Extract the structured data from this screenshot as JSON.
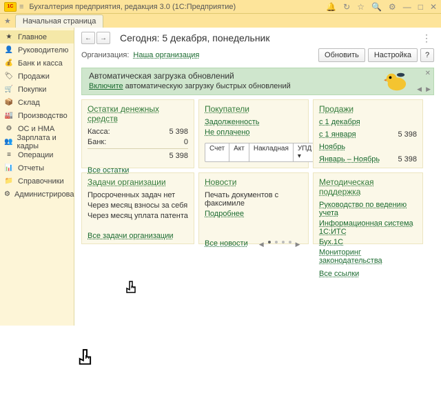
{
  "titlebar": {
    "title": "Бухгалтерия предприятия, редакция 3.0  (1С:Предприятие)"
  },
  "tab": {
    "label": "Начальная страница"
  },
  "sidebar": {
    "items": [
      {
        "label": "Главное",
        "icon": "★"
      },
      {
        "label": "Руководителю",
        "icon": "👤"
      },
      {
        "label": "Банк и касса",
        "icon": "💰"
      },
      {
        "label": "Продажи",
        "icon": "🏷"
      },
      {
        "label": "Покупки",
        "icon": "🛒"
      },
      {
        "label": "Склад",
        "icon": "📦"
      },
      {
        "label": "Производство",
        "icon": "🏭"
      },
      {
        "label": "ОС и НМА",
        "icon": "⚙"
      },
      {
        "label": "Зарплата и кадры",
        "icon": "👥"
      },
      {
        "label": "Операции",
        "icon": "≡"
      },
      {
        "label": "Отчеты",
        "icon": "📊"
      },
      {
        "label": "Справочники",
        "icon": "📁"
      },
      {
        "label": "Администрирование",
        "icon": "⚙"
      }
    ]
  },
  "page": {
    "title": "Сегодня: 5 декабря, понедельник"
  },
  "org": {
    "label": "Организация:",
    "value": "Наша организация"
  },
  "buttons": {
    "refresh": "Обновить",
    "settings": "Настройка",
    "help": "?"
  },
  "banner": {
    "title": "Автоматическая загрузка обновлений",
    "link": "Включите",
    "text": " автоматическую загрузку быстрых обновлений"
  },
  "cash": {
    "title": "Остатки денежных средств",
    "rows": [
      {
        "label": "Касса:",
        "value": "5 398"
      },
      {
        "label": "Банк:",
        "value": "0"
      }
    ],
    "total": "5 398",
    "more": "Все остатки"
  },
  "buyers": {
    "title": "Покупатели",
    "links": [
      "Задолженность",
      "Не оплачено"
    ],
    "tabs": [
      "Счет",
      "Акт",
      "Накладная",
      "УПД ▾"
    ]
  },
  "sales": {
    "title": "Продажи",
    "rows": [
      {
        "label": "с 1 декабря",
        "value": ""
      },
      {
        "label": "с 1 января",
        "value": "5 398"
      },
      {
        "label": "Ноябрь",
        "value": ""
      },
      {
        "label": "Январь – Ноябрь",
        "value": "5 398"
      }
    ]
  },
  "tasks": {
    "title": "Задачи организации",
    "items": [
      "Просроченных задач нет",
      "Через месяц взносы за себя",
      "Через месяц уплата патента"
    ],
    "more": "Все задачи организации"
  },
  "news": {
    "title": "Новости",
    "item": "Печать документов с факсимиле",
    "detail": "Подробнее",
    "more": "Все новости"
  },
  "support": {
    "title": "Методическая поддержка",
    "links": [
      "Руководство по ведению учета",
      "Информационная система 1С:ИТС",
      "Бух.1С",
      "Мониторинг законодательства"
    ],
    "more": "Все ссылки"
  }
}
